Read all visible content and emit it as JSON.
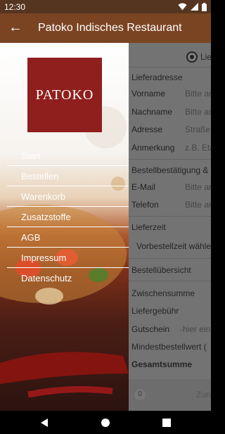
{
  "status": {
    "time": "12:30"
  },
  "app": {
    "title": "Patoko Indisches Restaurant"
  },
  "drawer": {
    "logo_text": "PATOKO",
    "items": [
      {
        "label": "Start"
      },
      {
        "label": "Bestellen"
      },
      {
        "label": "Warenkorb"
      },
      {
        "label": "Zusatzstoffe"
      },
      {
        "label": "AGB"
      },
      {
        "label": "Impressum"
      },
      {
        "label": "Datenschutz"
      }
    ]
  },
  "form": {
    "delivery_option": "Lie",
    "address_title": "Lieferadresse",
    "fields": [
      {
        "label": "Vorname",
        "placeholder": "Bitte an"
      },
      {
        "label": "Nachname",
        "placeholder": "Bitte an"
      },
      {
        "label": "Adresse",
        "placeholder": "Straße"
      },
      {
        "label": "Anmerkung",
        "placeholder": "z.B. Eta"
      }
    ],
    "confirm_title": "Bestellbestätigung &",
    "contact_fields": [
      {
        "label": "E-Mail",
        "placeholder": "Bitte an"
      },
      {
        "label": "Telefon",
        "placeholder": "Bitte an"
      }
    ],
    "delivery_time_title": "Lieferzeit",
    "delivery_time_value": "Vorbestellzeit wähle",
    "summary_title": "Bestellübersicht",
    "subtotal": "Zwischensumme",
    "fee": "Liefergebühr",
    "voucher_label": "Gutschein",
    "voucher_placeholder": "-hier ein",
    "minimum": "Mindestbestellwert (",
    "total": "Gesamtsumme",
    "cart_count": "0",
    "cart_button": "Zurü"
  }
}
